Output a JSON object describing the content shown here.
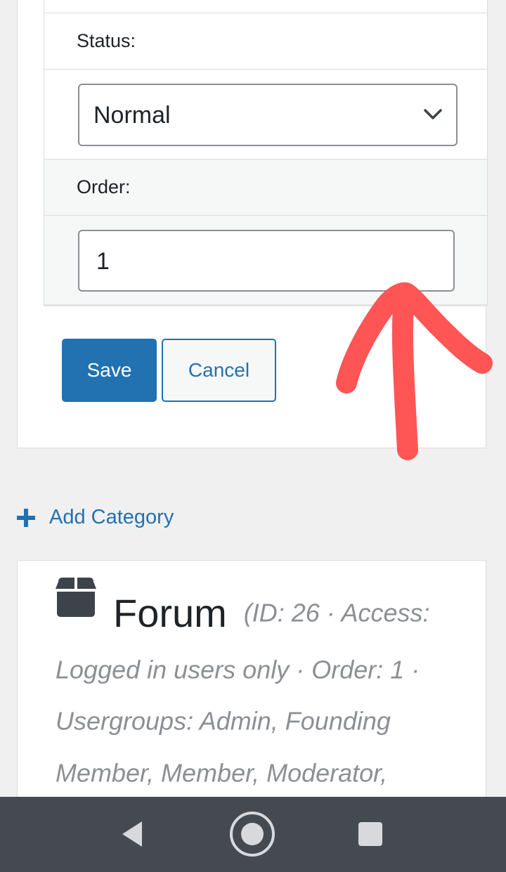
{
  "form": {
    "status_label": "Status:",
    "status_value": "Normal",
    "order_label": "Order:",
    "order_value": "1",
    "save_label": "Save",
    "cancel_label": "Cancel"
  },
  "add_category": {
    "label": "Add Category"
  },
  "forum": {
    "title": "Forum",
    "meta": "(ID: 26 · Access: Logged in users only · Order: 1 · Usergroups: Admin, Founding Member, Member, Moderator,"
  },
  "colors": {
    "accent": "#2271b1",
    "annotation_arrow": "#ff5555",
    "navbar": "#454a50"
  },
  "icons": {
    "add": "plus-icon",
    "forum": "box-icon",
    "select": "chevron-down-icon",
    "nav_back": "back-icon",
    "nav_home": "home-icon",
    "nav_recents": "recents-icon"
  }
}
